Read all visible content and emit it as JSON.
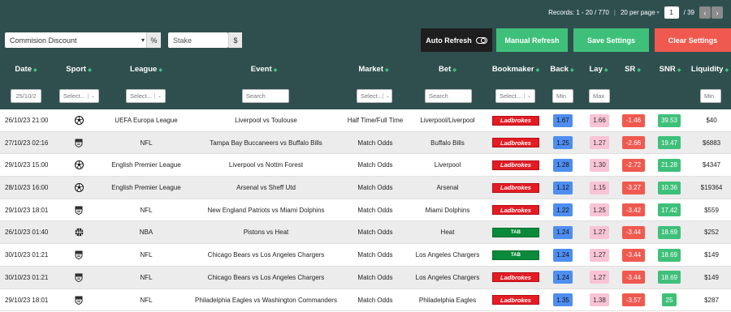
{
  "pagination": {
    "records": "Records: 1 - 20 / 770",
    "per_page": "20 per page",
    "per_page_caret": "▾",
    "page": "1",
    "total_pages": "/ 39",
    "prev": "‹",
    "next": "›"
  },
  "controls": {
    "commission": "Commision Discount",
    "commission_caret": "▾",
    "pct": "%",
    "stake_placeholder": "Stake",
    "dollar": "$"
  },
  "buttons": {
    "auto": "Auto Refresh",
    "manual": "Manual Refresh",
    "save": "Save Settings",
    "clear": "Clear Settings"
  },
  "headers": {
    "date": "Date",
    "sport": "Sport",
    "league": "League",
    "event": "Event",
    "market": "Market",
    "bet": "Bet",
    "bookmaker": "Bookmaker",
    "back": "Back",
    "lay": "Lay",
    "sr": "SR",
    "snr": "SNR",
    "liquidity": "Liquidity",
    "sort_icon": "◆"
  },
  "filters": {
    "date": "25/10/2",
    "sport": "Select...",
    "league": "Select...",
    "event": "Search",
    "market": "Select...",
    "bet": "Search",
    "bookmaker": "Select...",
    "back": "Min",
    "lay": "Max",
    "liquidity": "Min",
    "chevron": "⌄"
  },
  "rows": [
    {
      "date": "26/10/23 21:00",
      "sport": "soccer",
      "league": "UEFA Europa League",
      "event": "Liverpool vs Toulouse",
      "market": "Half Time/Full Time",
      "bet": "Liverpool/Liverpool",
      "bookmaker": "Ladbrokes",
      "back": "1.67",
      "lay": "1.66",
      "sr": "-1.46",
      "snr": "39.53",
      "liquidity": "$40"
    },
    {
      "date": "27/10/23 02:16",
      "sport": "nfl",
      "league": "NFL",
      "event": "Tampa Bay Buccaneers vs Buffalo Bills",
      "market": "Match Odds",
      "bet": "Buffalo Bills",
      "bookmaker": "Ladbrokes",
      "back": "1.25",
      "lay": "1.27",
      "sr": "-2.66",
      "snr": "19.47",
      "liquidity": "$6883"
    },
    {
      "date": "29/10/23 15:00",
      "sport": "soccer",
      "league": "English Premier League",
      "event": "Liverpool vs Nottm Forest",
      "market": "Match Odds",
      "bet": "Liverpool",
      "bookmaker": "Ladbrokes",
      "back": "1.28",
      "lay": "1.30",
      "sr": "-2.72",
      "snr": "21.28",
      "liquidity": "$4347"
    },
    {
      "date": "28/10/23 16:00",
      "sport": "soccer",
      "league": "English Premier League",
      "event": "Arsenal vs Sheff Utd",
      "market": "Match Odds",
      "bet": "Arsenal",
      "bookmaker": "Ladbrokes",
      "back": "1.12",
      "lay": "1.15",
      "sr": "-3.27",
      "snr": "10.36",
      "liquidity": "$19364"
    },
    {
      "date": "29/10/23 18:01",
      "sport": "nfl",
      "league": "NFL",
      "event": "New England Patriots vs Miami Dolphins",
      "market": "Match Odds",
      "bet": "Miami Dolphins",
      "bookmaker": "Ladbrokes",
      "back": "1.22",
      "lay": "1.25",
      "sr": "-3.42",
      "snr": "17.42",
      "liquidity": "$559"
    },
    {
      "date": "26/10/23 01:40",
      "sport": "nba",
      "league": "NBA",
      "event": "Pistons vs Heat",
      "market": "Match Odds",
      "bet": "Heat",
      "bookmaker": "TAB",
      "back": "1.24",
      "lay": "1.27",
      "sr": "-3.44",
      "snr": "18.69",
      "liquidity": "$252"
    },
    {
      "date": "30/10/23 01:21",
      "sport": "nfl",
      "league": "NFL",
      "event": "Chicago Bears vs Los Angeles Chargers",
      "market": "Match Odds",
      "bet": "Los Angeles Chargers",
      "bookmaker": "TAB",
      "back": "1.24",
      "lay": "1.27",
      "sr": "-3.44",
      "snr": "18.69",
      "liquidity": "$149"
    },
    {
      "date": "30/10/23 01:21",
      "sport": "nfl",
      "league": "NFL",
      "event": "Chicago Bears vs Los Angeles Chargers",
      "market": "Match Odds",
      "bet": "Los Angeles Chargers",
      "bookmaker": "Ladbrokes",
      "back": "1.24",
      "lay": "1.27",
      "sr": "-3.44",
      "snr": "18.69",
      "liquidity": "$149"
    },
    {
      "date": "29/10/23 18:01",
      "sport": "nfl",
      "league": "NFL",
      "event": "Philadelphia Eagles vs Washington Commanders",
      "market": "Match Odds",
      "bet": "Philadelphia Eagles",
      "bookmaker": "Ladbrokes",
      "back": "1.35",
      "lay": "1.38",
      "sr": "-3.57",
      "snr": "25",
      "liquidity": "$287"
    }
  ],
  "colors": {
    "header": "#2f4f4f",
    "green": "#3fc07a",
    "red": "#f0594f",
    "back": "#4f8df0",
    "lay": "#f9c3d6",
    "ladbrokes": "#e41b23",
    "tab": "#0a8a3a"
  }
}
